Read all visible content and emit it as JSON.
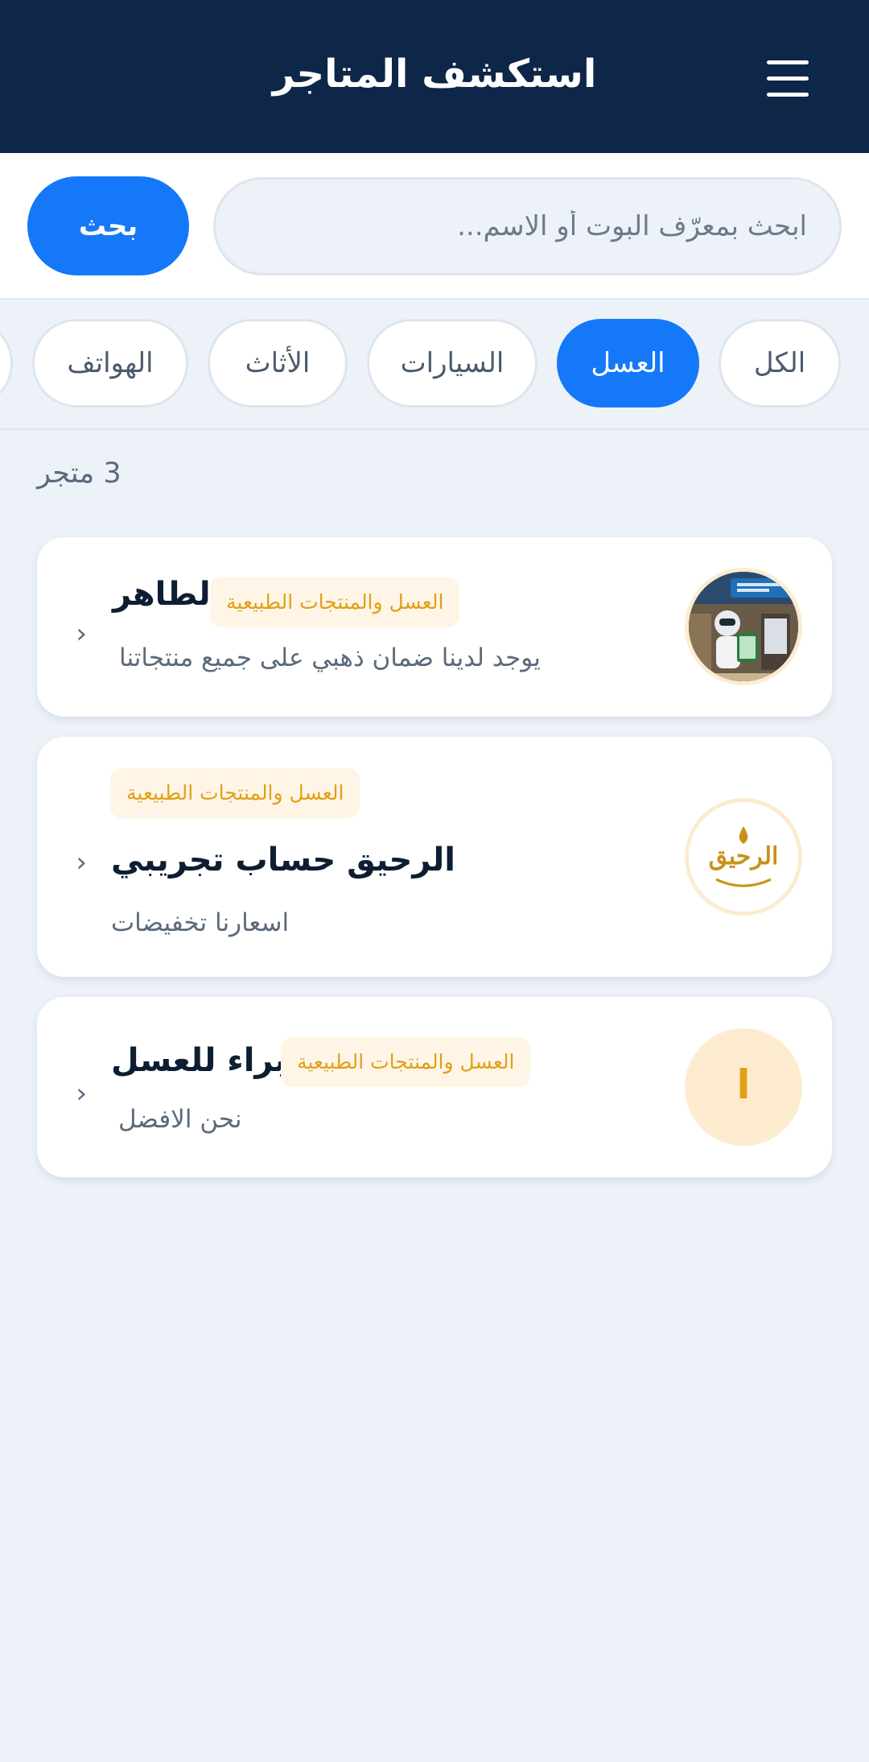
{
  "header": {
    "title": "استكشف المتاجر",
    "menu_icon": "menu-icon"
  },
  "search": {
    "placeholder": "ابحث بمعرّف البوت أو الاسم...",
    "value": "",
    "button_label": "بحث"
  },
  "categories": [
    {
      "label": "الكل",
      "active": false
    },
    {
      "label": "العسل",
      "active": true
    },
    {
      "label": "السيارات",
      "active": false
    },
    {
      "label": "الأثاث",
      "active": false
    },
    {
      "label": "الهواتف",
      "active": false
    }
  ],
  "results": {
    "count_label": "3 متجر"
  },
  "stores": [
    {
      "name": "الطاهر",
      "tag": "العسل والمنتجات الطبيعية",
      "description": "يوجد لدينا ضمان ذهبي على جميع منتجاتنا",
      "avatar": "robot-storefront-photo"
    },
    {
      "name": "الرحيق  حساب تجريبي",
      "tag": "العسل والمنتجات الطبيعية",
      "description": "اسعارنا تخفيضات",
      "avatar": "alraheeq-logo",
      "logo_text": "الرحيق"
    },
    {
      "name": "البراء للعسل",
      "tag": "العسل والمنتجات الطبيعية",
      "description": "نحن الافضل",
      "avatar": "letter-avatar",
      "avatar_letter": "ا"
    }
  ],
  "colors": {
    "header_bg": "#0e2647",
    "accent": "#1478f8",
    "tag_text": "#e0a018",
    "tag_bg": "#fff5e6",
    "page_bg": "#edf2f9"
  }
}
